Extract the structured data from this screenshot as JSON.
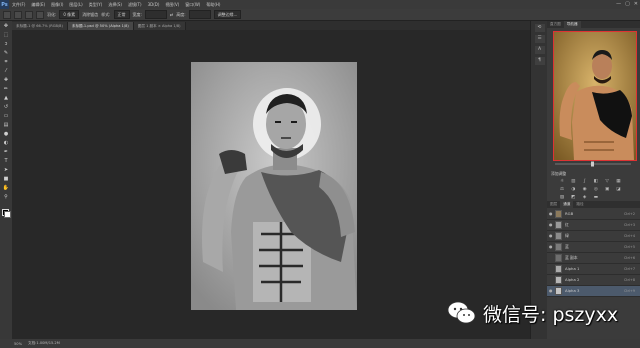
{
  "app": {
    "logo": "Ps"
  },
  "menu": [
    "文件(F)",
    "编辑(E)",
    "图像(I)",
    "图层(L)",
    "类型(Y)",
    "选择(S)",
    "滤镜(T)",
    "3D(D)",
    "视图(V)",
    "窗口(W)",
    "帮助(H)"
  ],
  "window_controls": [
    "—",
    "▢",
    "✕"
  ],
  "options_bar": {
    "feather_label": "羽化:",
    "feather_value": "0 像素",
    "antialias_label": "消除锯齿",
    "style_label": "样式:",
    "style_value": "正常",
    "width_label": "宽度:",
    "height_label": "高度:",
    "refine_edge_button": "调整边缘..."
  },
  "document_tabs": [
    {
      "label": "未标题-1 @ 66.7% (RGB/8)",
      "active": false
    },
    {
      "label": "未标题-1.psd @ 50% (Alpha 1/8)",
      "active": true
    },
    {
      "label": "图层 1 副本 × Alpha 1/8)",
      "active": false
    }
  ],
  "tools": [
    "move-tool",
    "marquee-tool",
    "lasso-tool",
    "quick-select-tool",
    "crop-tool",
    "eyedropper-tool",
    "healing-tool",
    "brush-tool",
    "stamp-tool",
    "history-brush-tool",
    "eraser-tool",
    "gradient-tool",
    "blur-tool",
    "dodge-tool",
    "pen-tool",
    "type-tool",
    "path-select-tool",
    "shape-tool",
    "hand-tool",
    "zoom-tool"
  ],
  "status_bar": {
    "zoom": "50%",
    "doc_info": "文档:1.00M/15.2M"
  },
  "right_panel": {
    "top_tabs": [
      "直方图",
      "导航器"
    ],
    "adjustments_title": "添加调整",
    "layer_tabs": [
      "图层",
      "通道",
      "路径"
    ],
    "layers": [
      {
        "name": "RGB",
        "shortcut": "Ctrl+2",
        "selected": false
      },
      {
        "name": "红",
        "shortcut": "Ctrl+3",
        "selected": false
      },
      {
        "name": "绿",
        "shortcut": "Ctrl+4",
        "selected": false
      },
      {
        "name": "蓝",
        "shortcut": "Ctrl+5",
        "selected": false
      },
      {
        "name": "蓝 副本",
        "shortcut": "Ctrl+6",
        "selected": false
      },
      {
        "name": "Alpha 1",
        "shortcut": "Ctrl+7",
        "selected": false
      },
      {
        "name": "Alpha 2",
        "shortcut": "Ctrl+8",
        "selected": false
      },
      {
        "name": "Alpha 3",
        "shortcut": "Ctrl+9",
        "selected": true
      }
    ]
  },
  "watermark": {
    "text": "微信号: pszyxx"
  },
  "colors": {
    "accent": "#4c5a6c",
    "nav_frame": "#dd3333"
  }
}
